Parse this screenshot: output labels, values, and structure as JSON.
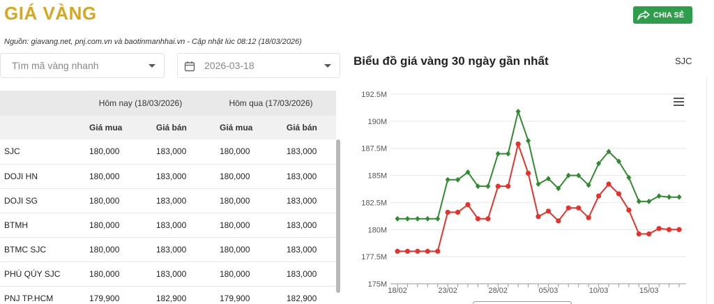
{
  "header": {
    "title": "GIÁ VÀNG",
    "share_label": "CHIA SẺ",
    "source": "Nguồn: giavang.net, pnj.com.vn và baotinmanhhai.vn - Cập nhật lúc 08:12 (18/03/2026)"
  },
  "filters": {
    "search_placeholder": "Tìm mã vàng nhanh",
    "date_value": "2026-03-18"
  },
  "table": {
    "group_headers": [
      "Hôm nay (18/03/2026)",
      "Hôm qua (17/03/2026)"
    ],
    "sub_headers": [
      "Giá mua",
      "Giá bán",
      "Giá mua",
      "Giá bán"
    ],
    "rows": [
      {
        "name": "SJC",
        "values": [
          "180,000",
          "183,000",
          "180,000",
          "183,000"
        ]
      },
      {
        "name": "DOJI HN",
        "values": [
          "180,000",
          "183,000",
          "180,000",
          "183,000"
        ]
      },
      {
        "name": "DOJI SG",
        "values": [
          "180,000",
          "183,000",
          "180,000",
          "183,000"
        ]
      },
      {
        "name": "BTMH",
        "values": [
          "180,000",
          "183,000",
          "180,000",
          "183,000"
        ]
      },
      {
        "name": "BTMC SJC",
        "values": [
          "180,000",
          "183,000",
          "180,000",
          "183,000"
        ]
      },
      {
        "name": "PHÚ QÚY SJC",
        "values": [
          "180,000",
          "183,000",
          "180,000",
          "183,000"
        ]
      },
      {
        "name": "PNJ TP.HCM",
        "values": [
          "179,900",
          "182,900",
          "179,900",
          "182,900"
        ]
      }
    ]
  },
  "chart": {
    "title": "Biểu đồ giá vàng 30 ngày gần nhất",
    "code": "SJC"
  },
  "chart_data": {
    "type": "line",
    "title": "Biểu đồ giá vàng 30 ngày gần nhất",
    "xlabel": "",
    "ylabel": "",
    "ylim": [
      175,
      192.5
    ],
    "y_ticks": [
      "175M",
      "177.5M",
      "180M",
      "182.5M",
      "185M",
      "187.5M",
      "190M",
      "192.5M"
    ],
    "y_tick_values": [
      175,
      177.5,
      180,
      182.5,
      185,
      187.5,
      190,
      192.5
    ],
    "x_ticks": [
      "18/02",
      "23/02",
      "28/02",
      "05/03",
      "10/03",
      "15/03"
    ],
    "x_tick_index": [
      0,
      5,
      10,
      15,
      20,
      25
    ],
    "grid": true,
    "legend": "none",
    "colors": {
      "upper": "#2e8b2e",
      "lower": "#e8312a"
    },
    "series": [
      {
        "values": [
          181,
          181,
          181,
          181,
          181,
          184.6,
          184.6,
          185.3,
          184,
          184,
          187,
          187,
          190.9,
          188.2,
          184.2,
          184.7,
          183.8,
          185,
          185,
          184.1,
          186.1,
          187.2,
          186.3,
          184.8,
          182.6,
          182.6,
          183.1,
          183,
          183
        ]
      },
      {
        "values": [
          178,
          178,
          178,
          178,
          178,
          181.6,
          181.6,
          182.3,
          181,
          181,
          184,
          184,
          187.9,
          185.2,
          181.2,
          181.7,
          180.8,
          182,
          182,
          181.1,
          183.1,
          184.2,
          183.3,
          181.8,
          179.6,
          179.6,
          180.1,
          180,
          180
        ]
      }
    ]
  }
}
